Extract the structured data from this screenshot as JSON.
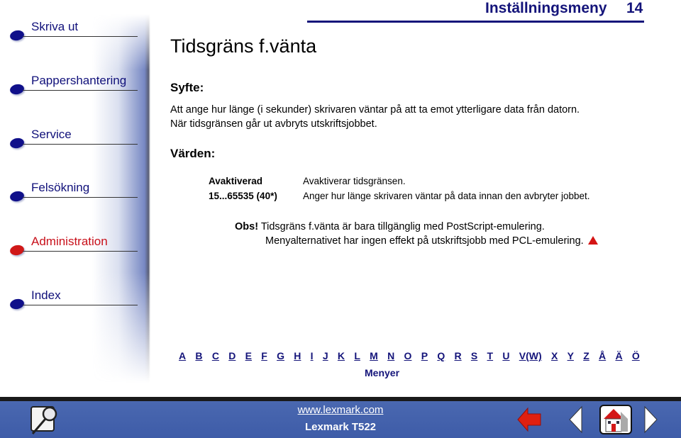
{
  "sidebar": {
    "items": [
      {
        "label": "Skriva ut",
        "active": false
      },
      {
        "label": "Pappershantering",
        "active": false
      },
      {
        "label": "Service",
        "active": false
      },
      {
        "label": "Felsökning",
        "active": false
      },
      {
        "label": "Administration",
        "active": true
      },
      {
        "label": "Index",
        "active": false
      }
    ]
  },
  "header": {
    "section_title": "Inställningsmeny",
    "page_number": "14"
  },
  "content": {
    "title": "Tidsgräns f.vänta",
    "purpose_heading": "Syfte:",
    "purpose_lines": [
      "Att ange hur länge (i sekunder) skrivaren väntar på att ta emot ytterligare data från datorn.",
      "När tidsgränsen går ut avbryts utskriftsjobbet."
    ],
    "values_heading": "Värden:",
    "values": [
      {
        "key": "Avaktiverad",
        "desc": "Avaktiverar tidsgränsen."
      },
      {
        "key": "15...65535 (40*)",
        "desc": "Anger hur länge skrivaren väntar på data innan den avbryter jobbet."
      }
    ],
    "note": {
      "label": "Obs!",
      "line1": "Tidsgräns f.vänta är bara tillgänglig med PostScript-emulering.",
      "line2": "Menyalternativet har ingen effekt på utskriftsjobb med PCL-emulering."
    }
  },
  "index_bar": {
    "letters": [
      "A",
      "B",
      "C",
      "D",
      "E",
      "F",
      "G",
      "H",
      "I",
      "J",
      "K",
      "L",
      "M",
      "N",
      "O",
      "P",
      "Q",
      "R",
      "S",
      "T",
      "U",
      "V(W)",
      "X",
      "Y",
      "Z",
      "Å",
      "Ä",
      "Ö"
    ],
    "menus_label": "Menyer"
  },
  "footer": {
    "url": "www.lexmark.com",
    "model": "Lexmark T522",
    "icons": [
      "search-icon",
      "back-arrow-icon",
      "previous-page-icon",
      "home-icon",
      "next-page-icon"
    ]
  },
  "colors": {
    "nav_blue": "#10107a",
    "nav_active_red": "#c8101a",
    "footer_blue": "#4564ac"
  }
}
